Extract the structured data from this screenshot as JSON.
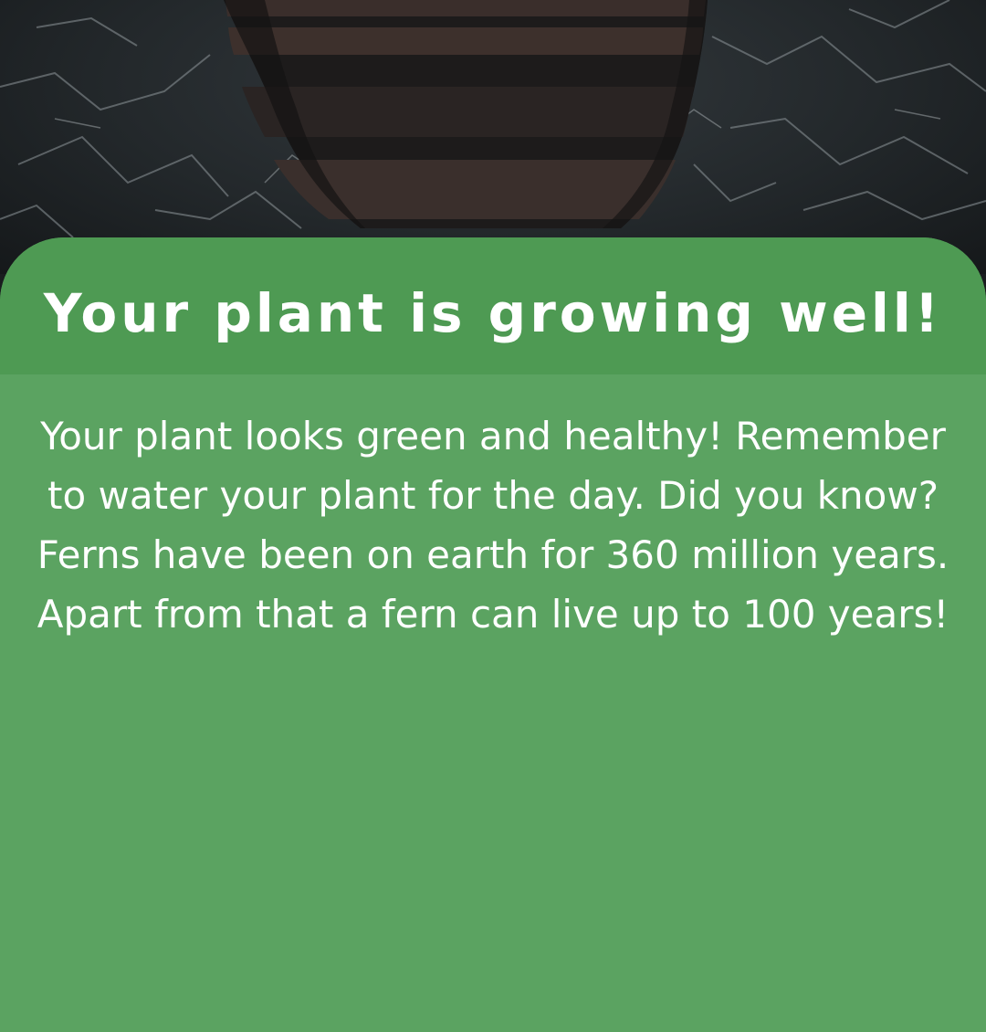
{
  "background": {
    "scene_icon": "planter-pot-on-marble-icon",
    "colors": {
      "marble": "#23282b",
      "pot_light": "#3d302c",
      "pot_dark": "#1d1b1b"
    }
  },
  "card": {
    "title": "Your plant is growing well!",
    "message": "Your plant looks green and healthy! Remember to water your plant for the day. Did you know? Ferns have been on earth for 360 million years. Apart from that a fern can live up to 100 years!",
    "colors": {
      "header": "#4e9a53",
      "body": "#5ba361",
      "text": "#ffffff"
    }
  }
}
